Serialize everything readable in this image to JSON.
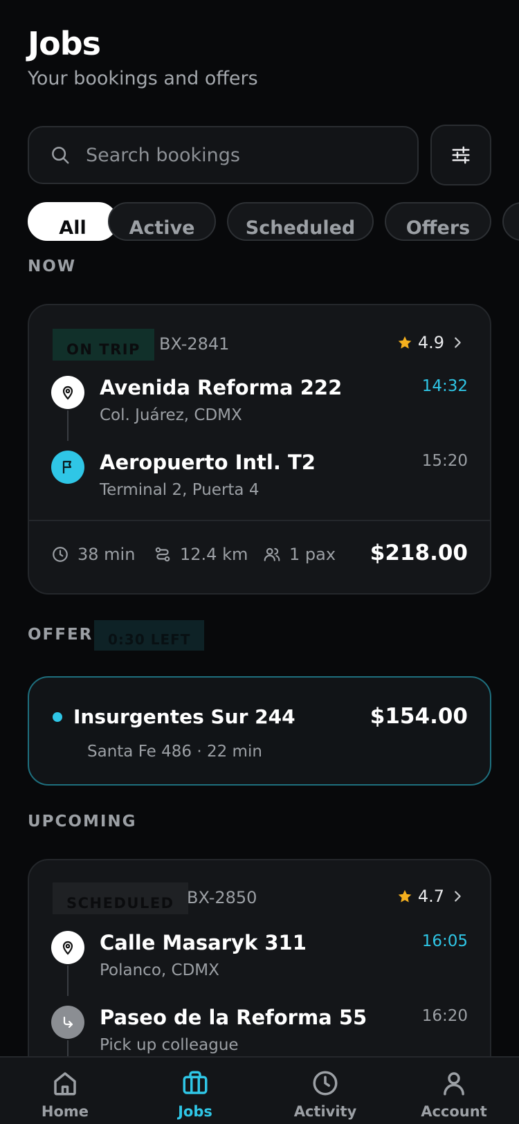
{
  "header": {
    "title": "Jobs",
    "subtitle": "Your bookings and offers"
  },
  "search": {
    "placeholder": "Search bookings"
  },
  "chips": [
    "All",
    "Active",
    "Scheduled",
    "Offers"
  ],
  "sections": {
    "now": "NOW",
    "offer": "OFFER",
    "upcoming": "UPCOMING"
  },
  "current_trip": {
    "status": "ON TRIP",
    "id": "BX-2841",
    "rating": "4.9",
    "pickup": {
      "name": "Avenida Reforma 222",
      "sub": "Col. Juárez, CDMX",
      "time": "14:32"
    },
    "dropoff": {
      "name": "Aeropuerto Intl. T2",
      "sub": "Terminal 2, Puerta 4",
      "time": "15:20"
    },
    "duration": "38 min",
    "distance": "12.4 km",
    "passengers": "1 pax",
    "price": "$218.00"
  },
  "offer": {
    "timer": "0:30 LEFT",
    "name": "Insurgentes Sur 244",
    "detail": "Santa Fe 486 · 22 min",
    "price": "$154.00"
  },
  "upcoming_trip": {
    "status": "SCHEDULED",
    "id": "BX-2850",
    "rating": "4.7",
    "pickup": {
      "name": "Calle Masaryk 311",
      "sub": "Polanco, CDMX",
      "time": "16:05"
    },
    "stop": {
      "name": "Paseo de la Reforma 55",
      "sub": "Pick up colleague",
      "time": "16:20"
    }
  },
  "tabs": [
    {
      "label": "Home",
      "icon": "home-icon"
    },
    {
      "label": "Jobs",
      "icon": "briefcase-icon"
    },
    {
      "label": "Activity",
      "icon": "clock-icon"
    },
    {
      "label": "Account",
      "icon": "user-icon"
    }
  ],
  "colors": {
    "accent": "#2fc6e6",
    "background": "#08090b",
    "card": "#141619",
    "star": "#f5b01e",
    "on_trip_badge": "#11302a",
    "scheduled_badge": "#1f2124"
  }
}
